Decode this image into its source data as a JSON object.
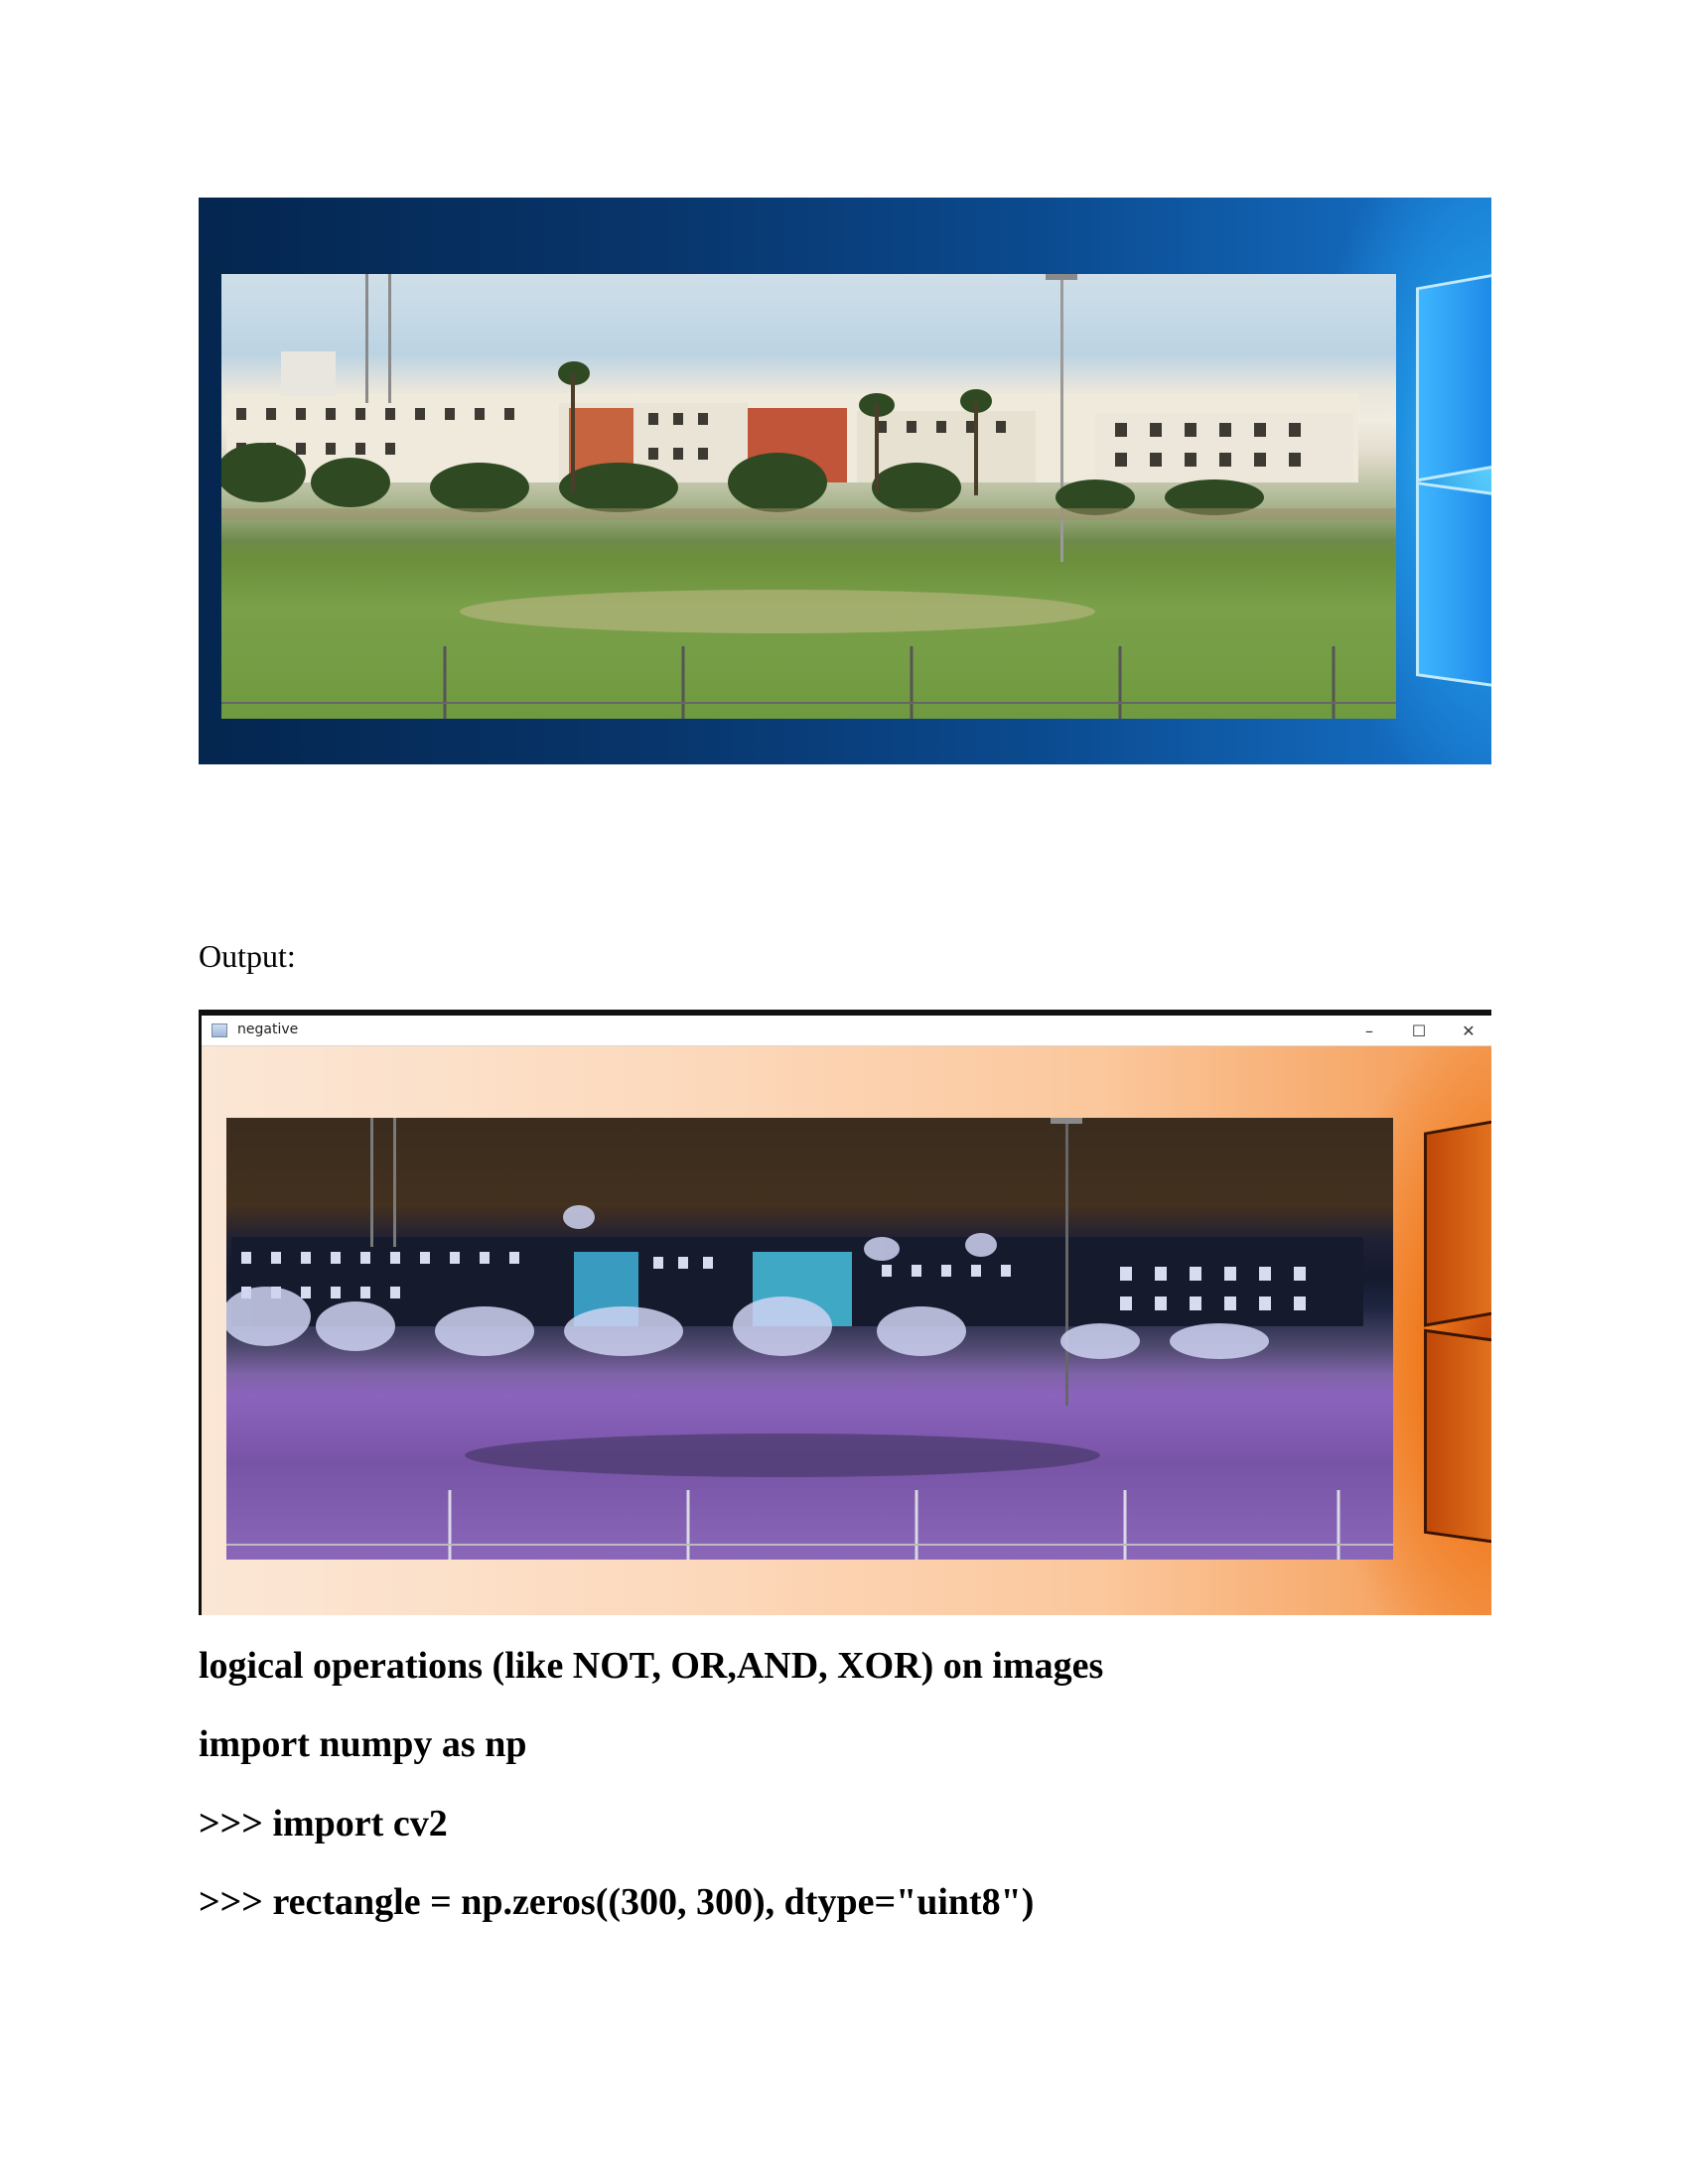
{
  "document": {
    "output_label": "Output:",
    "window": {
      "title": "negative",
      "minimize_glyph": "–",
      "maximize_glyph": "☐",
      "close_glyph": "✕"
    },
    "lines": [
      "logical operations (like NOT, OR,AND, XOR) on images",
      "import numpy as np",
      ">>> import cv2",
      ">>> rectangle = np.zeros((300, 300), dtype=\"uint8\")"
    ]
  },
  "icons": {
    "app": "app-window-icon",
    "minimize": "minimize-icon",
    "maximize": "maximize-icon",
    "close": "close-icon"
  }
}
